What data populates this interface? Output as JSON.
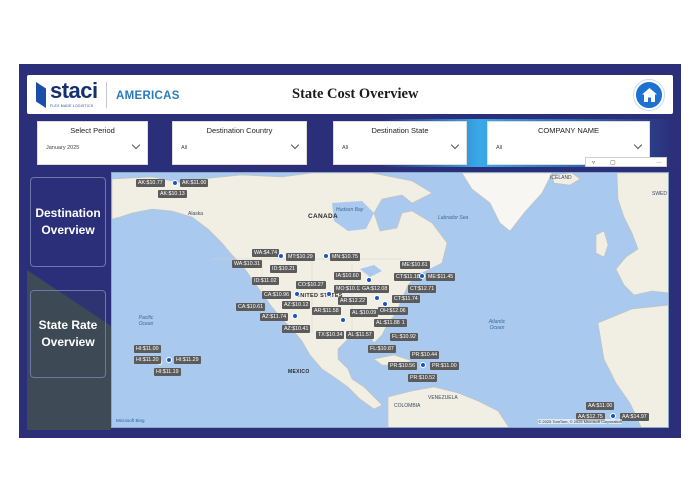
{
  "header": {
    "logo_text": "staci",
    "logo_sub": "FLEX MADE LOGISTICS",
    "region": "AMERICAS",
    "title": "State Cost Overview"
  },
  "filters": [
    {
      "label": "Select Period",
      "value": "January 2025"
    },
    {
      "label": "Destination Country",
      "value": "All"
    },
    {
      "label": "Destination State",
      "value": "All"
    },
    {
      "label": "COMPANY NAME",
      "value": "All"
    }
  ],
  "nav": {
    "item1": "Destination Overview",
    "item2": "State Rate Overview"
  },
  "map": {
    "labels": {
      "canada": "CANADA",
      "usa": "UNITED STATES",
      "mexico": "MEXICO",
      "venezuela": "VENEZUELA",
      "colombia": "COLOMBIA",
      "iceland": "ICELAND",
      "alaska": "Alaska",
      "hudson": "Hudson Bay",
      "labrador": "Labrador Sea",
      "pacific": "Pacific Ocean",
      "atlantic": "Atlantic Ocean",
      "sweden": "SWED"
    },
    "pins": [
      {
        "text": "AK:$10.77"
      },
      {
        "text": "AK:$11.00"
      },
      {
        "text": "AK:$10.13"
      },
      {
        "text": "WA:$4.74"
      },
      {
        "text": "WA:$10.31"
      },
      {
        "text": "MT:$10.29"
      },
      {
        "text": "MN:$10.75"
      },
      {
        "text": "ID:$10.21"
      },
      {
        "text": "ID:$11.02"
      },
      {
        "text": "ME:$10.61"
      },
      {
        "text": "CT:$11.18"
      },
      {
        "text": "ME:$11.45"
      },
      {
        "text": "IA:$10.60"
      },
      {
        "text": "CO:$10.27"
      },
      {
        "text": "CT:$12.71"
      },
      {
        "text": "CA:$10.96"
      },
      {
        "text": "AZ:$10.12"
      },
      {
        "text": "CA:$10.61"
      },
      {
        "text": "AZ:$11.74"
      },
      {
        "text": "AZ:$10.41"
      },
      {
        "text": "MO:$10.12"
      },
      {
        "text": "AR:$12.22"
      },
      {
        "text": "AL:$10.09"
      },
      {
        "text": "GA:$12.08"
      },
      {
        "text": "OH:$12.06"
      },
      {
        "text": "CT:$11.74"
      },
      {
        "text": "SC:$11.01"
      },
      {
        "text": "AR:$11.58"
      },
      {
        "text": "TX:$10.34"
      },
      {
        "text": "AL:$11.57"
      },
      {
        "text": "AL:$11.88"
      },
      {
        "text": "FL:$10.92"
      },
      {
        "text": "FL:$10.87"
      },
      {
        "text": "HI:$11.00"
      },
      {
        "text": "HI:$11.20"
      },
      {
        "text": "HI:$11.29"
      },
      {
        "text": "HI:$11.19"
      },
      {
        "text": "PR:$10.44"
      },
      {
        "text": "PR:$10.56"
      },
      {
        "text": "PR:$11.00"
      },
      {
        "text": "PR:$10.52"
      },
      {
        "text": "AA:$11.00"
      },
      {
        "text": "AA:$12.75"
      },
      {
        "text": "AA:$14.97"
      }
    ],
    "copyright": "© 2025 TomTom, © 2025 Microsoft Corporation",
    "bing": "Microsoft Bing"
  },
  "colors": {
    "navy": "#2b2f7a",
    "accent_blue": "#1d72d1",
    "pin_bg": "#5b5b5b",
    "dot": "#1656c9",
    "water": "#a9c9ee",
    "land": "#f1eee4"
  }
}
